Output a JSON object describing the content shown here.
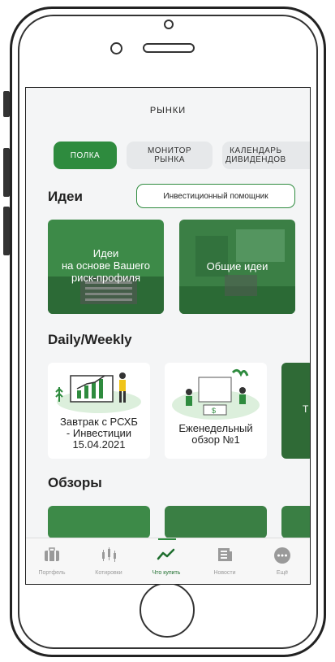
{
  "header": {
    "title": "РЫНКИ"
  },
  "tabs": [
    {
      "label": "ПОЛКА",
      "active": true
    },
    {
      "label": "МОНИТОР\nРЫНКА",
      "active": false
    },
    {
      "label": "КАЛЕНДАРЬ\nДИВИДЕНДОВ",
      "active": false
    }
  ],
  "ideas": {
    "heading": "Идеи",
    "assistant_button": "Инвестиционный помощник",
    "cards": [
      {
        "label": "Идеи\nна основе Вашего\nриск-профиля"
      },
      {
        "label": "Общие идеи"
      }
    ]
  },
  "daily": {
    "heading": "Daily/Weekly",
    "cards": [
      {
        "label": "Завтрак с РСХБ\n- Инвестиции\n15.04.2021"
      },
      {
        "label": "Еженедельный\nобзор №1"
      }
    ]
  },
  "reviews": {
    "heading": "Обзоры"
  },
  "bottom_nav": [
    {
      "label": "Портфель",
      "icon": "briefcase-icon",
      "active": false
    },
    {
      "label": "Котировки",
      "icon": "candles-icon",
      "active": false
    },
    {
      "label": "Что купить",
      "icon": "trend-icon",
      "active": true
    },
    {
      "label": "Новости",
      "icon": "news-icon",
      "active": false
    },
    {
      "label": "Ещё",
      "icon": "more-icon",
      "active": false
    }
  ],
  "colors": {
    "accent": "#2e8b3e",
    "card_green": "#2f7d3d",
    "background": "#f4f5f6"
  }
}
